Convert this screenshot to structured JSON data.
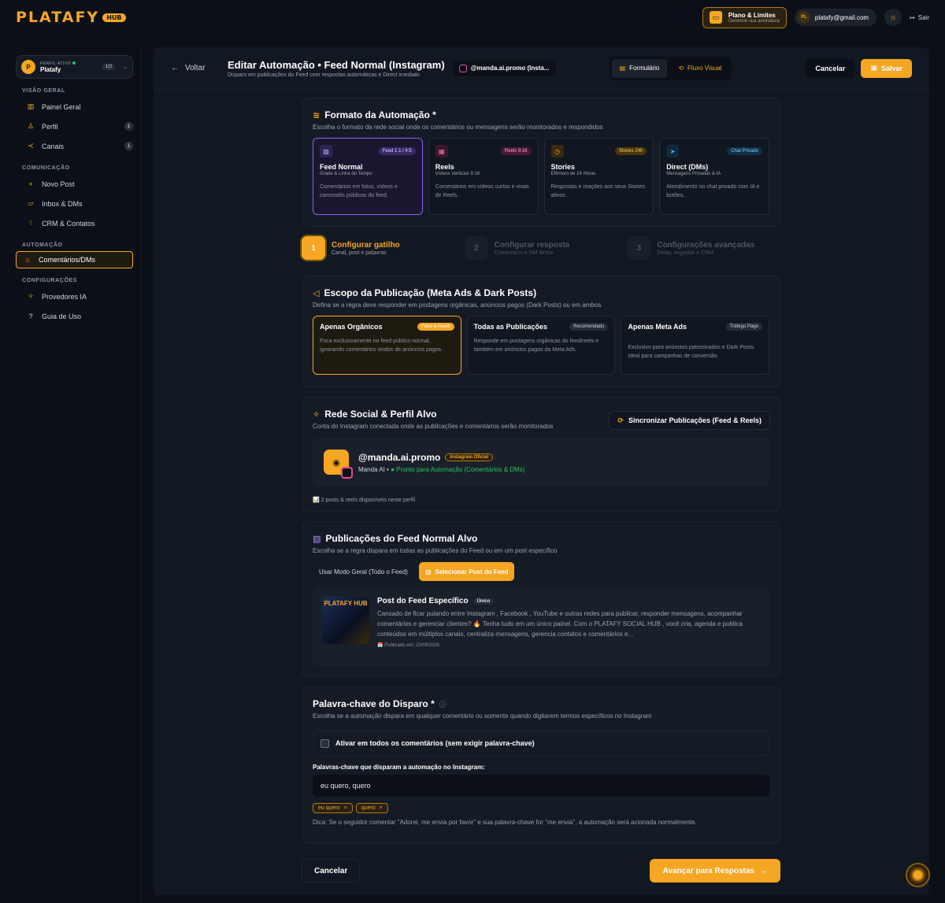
{
  "brand": {
    "name": "PLATAFY",
    "badge": "HUB"
  },
  "topbar": {
    "plan_title": "Plano & Limites",
    "plan_sub": "Gerencie sua assinatura",
    "user_initials": "PL",
    "user_email": "platafy@gmail.com",
    "logout_label": "Sair"
  },
  "sidebar": {
    "profile_label": "PERFIL ATIVO",
    "profile_name": "Platafy",
    "profile_count": "1/2",
    "sections": {
      "overview": "VISÃO GERAL",
      "communication": "COMUNICAÇÃO",
      "automation": "AUTOMAÇÃO",
      "settings": "CONFIGURAÇÕES"
    },
    "items": {
      "dashboard": "Painel Geral",
      "profile": "Perfil",
      "profile_badge": "1",
      "channels": "Canais",
      "channels_badge": "1",
      "new_post": "Novo Post",
      "inbox": "Inbox & DMs",
      "crm": "CRM & Contatos",
      "comments": "Comentários/DMs",
      "ai_providers": "Provedores IA",
      "guide": "Guia de Uso"
    }
  },
  "header": {
    "back_label": "Voltar",
    "title": "Editar Automação • Feed Normal (Instagram)",
    "subtitle": "Disparo em publicações do Feed com respostas automáticas e Direct imediato",
    "account": "@manda.ai.promo (Insta...",
    "mode_form": "Formulário",
    "mode_flow": "Fluxo Visual",
    "cancel_label": "Cancelar",
    "save_label": "Salvar"
  },
  "format": {
    "title": "Formato da Automação *",
    "desc": "Escolha o formato da rede social onde os comentários ou mensagens serão monitorados e respondidos",
    "options": [
      {
        "name": "Feed Normal",
        "tag": "Feed 1:1 / 4:5",
        "sub": "Grade & Linha do Tempo",
        "desc": "Comentários em fotos, vídeos e carrosséis públicos do feed."
      },
      {
        "name": "Reels",
        "tag": "Reels 9:16",
        "sub": "Vídeos Verticais 9:16",
        "desc": "Comentários em vídeos curtos e virais de Reels."
      },
      {
        "name": "Stories",
        "tag": "Stories 24h",
        "sub": "Efêmero de 24 Horas",
        "desc": "Respostas e reações aos seus Stories ativos."
      },
      {
        "name": "Direct (DMs)",
        "tag": "Chat Privado",
        "sub": "Mensagens Privadas & IA",
        "desc": "Atendimento no chat privado com IA e botões."
      }
    ]
  },
  "steps": [
    {
      "num": "1",
      "title": "Configurar gatilho",
      "sub": "Canal, post e palavras"
    },
    {
      "num": "2",
      "title": "Configurar resposta",
      "sub": "Comentário e DM direta"
    },
    {
      "num": "3",
      "title": "Configurações avançadas",
      "sub": "Delay, seguidor e CRM"
    }
  ],
  "scope": {
    "title": "Escopo da Publicação (Meta Ads & Dark Posts)",
    "desc": "Defina se a regra deve responder em postagens orgânicas, anúncios pagos (Dark Posts) ou em ambos",
    "options": [
      {
        "name": "Apenas Orgânicos",
        "tag": "Feed & Reels",
        "desc": "Foca exclusivamente no feed público normal, ignorando comentários vindos de anúncios pagos."
      },
      {
        "name": "Todas as Publicações",
        "tag": "Recomendado",
        "desc": "Responde em postagens orgânicas do feed/reels e também em anúncios pagos da Meta Ads."
      },
      {
        "name": "Apenas Meta Ads",
        "tag": "Tráfego Pago",
        "desc": "Exclusivo para anúncios patrocinados e Dark Posts. Ideal para campanhas de conversão."
      }
    ]
  },
  "network": {
    "title": "Rede Social & Perfil Alvo",
    "desc": "Conta do Instagram conectada onde as publicações e comentários serão monitorados",
    "sync_label": "Sincronizar Publicações (Feed & Reels)",
    "username": "@manda.ai.promo",
    "official": "Instagram Oficial",
    "display_name": "Manda AI",
    "separator": "•",
    "status": "Pronto para Automação (Comentários & DMs)",
    "available": "📊 2 posts & reels disponíveis neste perfil"
  },
  "feed": {
    "title": "Publicações do Feed Normal Alvo",
    "desc": "Escolha se a regra dispara em todas as publicações do Feed ou em um post específico",
    "general_label": "Usar Modo Geral (Todo o Feed)",
    "select_label": "Selecionar Post do Feed",
    "thumb_text": "PLATAFY HUB",
    "post_title": "Post do Feed Específico",
    "post_badge": "Único",
    "post_desc": "Cansado de ficar pulando entre Instagram , Facebook , YouTube e outras redes para publicar, responder mensagens, acompanhar comentários e gerenciar clientes? 🔥 Tenha tudo em um único painel. Com o PLATAFY SOCIAL HUB , você cria, agenda e publica conteúdos em múltiplos canais, centraliza mensagens, gerencia contatos e comentários e...",
    "post_date": "📅 Publicado em: 23/09/2026"
  },
  "keywords": {
    "title": "Palavra-chave do Disparo *",
    "desc": "Escolha se a automação dispara em qualquer comentário ou somente quando digitarem termos específicos no Instagram",
    "all_comments": "Ativar em todos os comentários (sem exigir palavra-chave)",
    "input_label": "Palavras-chave que disparam a automação no Instagram:",
    "input_value": "eu quero, quero",
    "chips": [
      "eu quero",
      "quero"
    ],
    "tip": "Dica: Se o seguidor comentar \"Adorei, me envia por favor\" e sua palavra-chave for \"me envia\", a automação será acionada normalmente."
  },
  "footer": {
    "cancel_label": "Cancelar",
    "next_label": "Avançar para Respostas"
  },
  "colors": {
    "accent": "#f5a623",
    "selected_format": "#8b5cf6",
    "success": "#22c55e"
  }
}
